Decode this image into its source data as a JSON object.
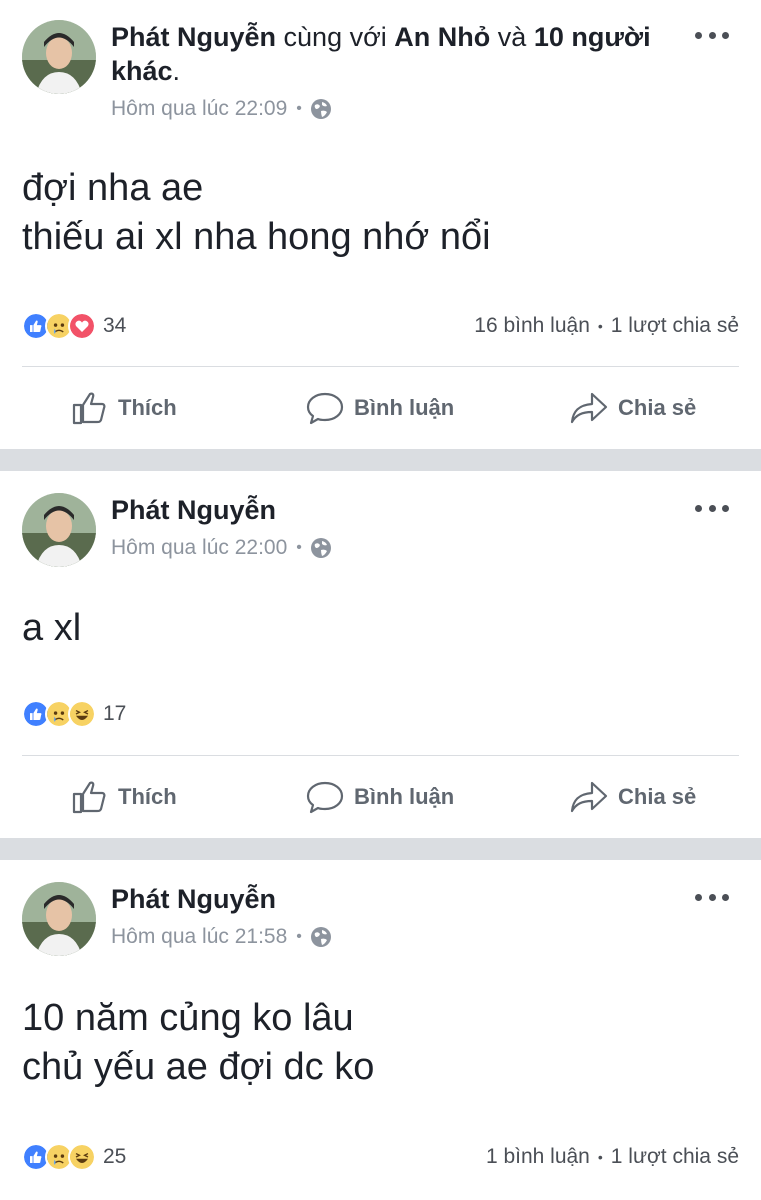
{
  "posts": [
    {
      "author": "Phát Nguyễn",
      "with_text": " cùng với ",
      "tagged_name": "An Nhỏ",
      "and_text": " và ",
      "others": "10 người khác",
      "end_text": ".",
      "time": "Hôm qua lúc 22:09",
      "lines": [
        "đợi nha ae",
        "thiếu ai xl nha hong nhớ nổi"
      ],
      "reaction_icons": [
        "like-icon",
        "sad-icon",
        "love-icon"
      ],
      "reaction_count": "34",
      "comments": "16 bình luận",
      "shares": "1 lượt chia sẻ"
    },
    {
      "author": "Phát Nguyễn",
      "time": "Hôm qua lúc 22:00",
      "lines": [
        "a xl"
      ],
      "reaction_icons": [
        "like-icon",
        "sad-icon",
        "haha-icon"
      ],
      "reaction_count": "17"
    },
    {
      "author": "Phát Nguyễn",
      "time": "Hôm qua lúc 21:58",
      "lines": [
        "10 năm củng ko lâu",
        "chủ yếu ae đợi dc ko"
      ],
      "reaction_icons": [
        "like-icon",
        "sad-icon",
        "haha-icon"
      ],
      "reaction_count": "25",
      "comments": "1 bình luận",
      "shares": "1 lượt chia sẻ"
    }
  ],
  "actions": {
    "like": "Thích",
    "comment": "Bình luận",
    "share": "Chia sẻ"
  },
  "meta_separator": "•",
  "stats_separator": "•",
  "colors": {
    "like_blue": "#4080ff",
    "love_red": "#f25268",
    "sad_yellow": "#f7d263",
    "divider_gray": "#dadde1",
    "meta_gray": "#8d949e"
  }
}
